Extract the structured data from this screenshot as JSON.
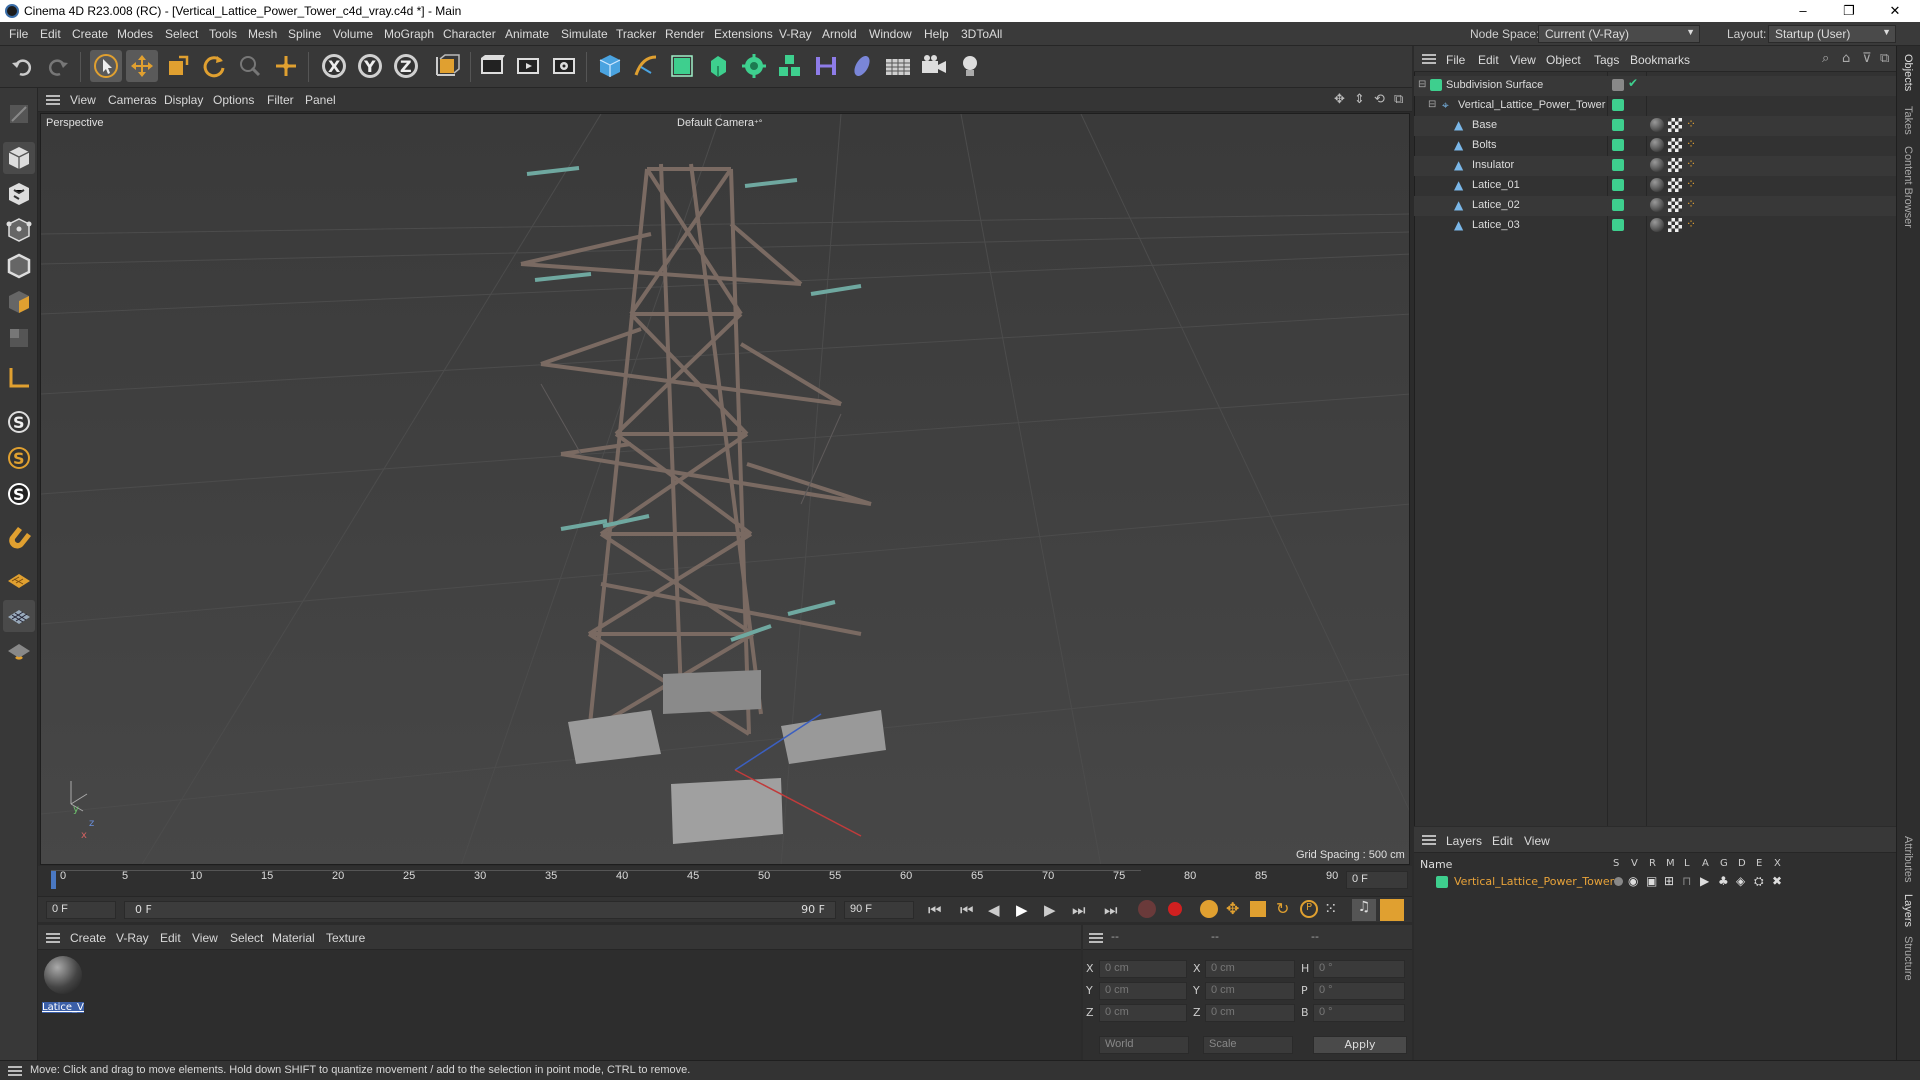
{
  "window": {
    "title": "Cinema 4D R23.008 (RC) - [Vertical_Lattice_Power_Tower_c4d_vray.c4d *] - Main",
    "minimize": "–",
    "maximize": "❐",
    "close": "✕"
  },
  "menubar": {
    "items": [
      "File",
      "Edit",
      "Create",
      "Modes",
      "Select",
      "Tools",
      "Mesh",
      "Spline",
      "Volume",
      "MoGraph",
      "Character",
      "Animate",
      "Simulate",
      "Tracker",
      "Render",
      "Extensions",
      "V-Ray",
      "Arnold",
      "Window",
      "Help",
      "3DToAll"
    ],
    "node_space_label": "Node Space:",
    "node_space_value": "Current (V-Ray)",
    "layout_label": "Layout:",
    "layout_value": "Startup (User)"
  },
  "viewport_menu": {
    "items": [
      "View",
      "Cameras",
      "Display",
      "Options",
      "Filter",
      "Panel"
    ],
    "view_name": "Perspective",
    "camera": "Default Camera",
    "grid_spacing": "Grid Spacing : 500 cm",
    "axis_labels": [
      "y",
      "z",
      "x"
    ]
  },
  "timeline": {
    "ticks": [
      "0",
      "5",
      "10",
      "15",
      "20",
      "25",
      "30",
      "35",
      "40",
      "45",
      "50",
      "55",
      "60",
      "65",
      "70",
      "75",
      "80",
      "85",
      "90"
    ],
    "current_frame_field": "0 F"
  },
  "transport": {
    "start_field": "0 F",
    "range_start": "0 F",
    "range_end": "90 F",
    "end_field": "90 F"
  },
  "material_menu": {
    "items": [
      "Create",
      "V-Ray",
      "Edit",
      "View",
      "Select",
      "Material",
      "Texture"
    ],
    "material_name": "Latice_Vi"
  },
  "coordinates": {
    "headers": [
      "--",
      "--",
      "--"
    ],
    "rows": [
      {
        "a": "X",
        "av": "0 cm",
        "b": "X",
        "bv": "0 cm",
        "c": "H",
        "cv": "0 °"
      },
      {
        "a": "Y",
        "av": "0 cm",
        "b": "Y",
        "bv": "0 cm",
        "c": "P",
        "cv": "0 °"
      },
      {
        "a": "Z",
        "av": "0 cm",
        "b": "Z",
        "bv": "0 cm",
        "c": "B",
        "cv": "0 °"
      }
    ],
    "mode": "World",
    "scale_mode": "Scale",
    "apply": "Apply"
  },
  "objects_menu": {
    "items": [
      "File",
      "Edit",
      "View",
      "Object",
      "Tags",
      "Bookmarks"
    ]
  },
  "objects": [
    {
      "name": "Subdivision Surface",
      "level": 0
    },
    {
      "name": "Vertical_Lattice_Power_Tower",
      "level": 1
    },
    {
      "name": "Base",
      "level": 2
    },
    {
      "name": "Bolts",
      "level": 2
    },
    {
      "name": "Insulator",
      "level": 2
    },
    {
      "name": "Latice_01",
      "level": 2
    },
    {
      "name": "Latice_02",
      "level": 2
    },
    {
      "name": "Latice_03",
      "level": 2
    }
  ],
  "layers_menu": {
    "items": [
      "Layers",
      "Edit",
      "View"
    ],
    "name_header": "Name",
    "flags": [
      "S",
      "V",
      "R",
      "M",
      "L",
      "A",
      "G",
      "D",
      "E",
      "X"
    ],
    "layer_name": "Vertical_Lattice_Power_Tower"
  },
  "side_tabs": [
    "Objects",
    "Takes",
    "Content Browser",
    "Attributes",
    "Layers",
    "Structure"
  ],
  "status": "Move: Click and drag to move elements. Hold down SHIFT to quantize movement / add to the selection in point mode, CTRL to remove.",
  "colors": {
    "accent_green": "#3ecf8e",
    "layer_orange": "#e8a33a",
    "selection_blue": "#4a78c2"
  }
}
